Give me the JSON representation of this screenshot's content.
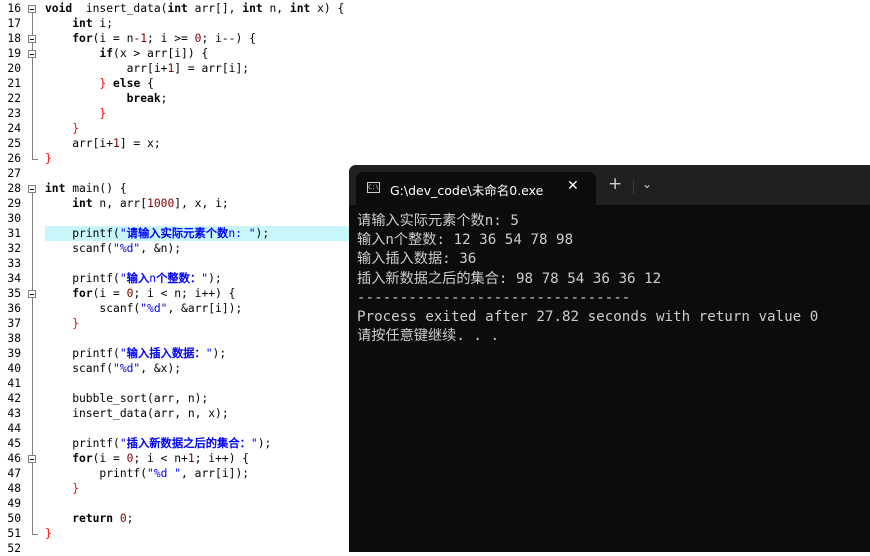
{
  "editor": {
    "highlight_line": "31",
    "lines": [
      {
        "n": "16",
        "fold": "box",
        "segs": [
          [
            "kw",
            "void"
          ],
          [
            "",
            "  insert_data("
          ],
          [
            "kw",
            "int"
          ],
          [
            "",
            " arr[], "
          ],
          [
            "kw",
            "int"
          ],
          [
            "",
            " n, "
          ],
          [
            "kw",
            "int"
          ],
          [
            "",
            " x) {"
          ]
        ]
      },
      {
        "n": "17",
        "fold": "line",
        "segs": [
          [
            "",
            "    "
          ],
          [
            "kw",
            "int"
          ],
          [
            "",
            " i;"
          ]
        ]
      },
      {
        "n": "18",
        "fold": "box",
        "segs": [
          [
            "",
            "    "
          ],
          [
            "kw",
            "for"
          ],
          [
            "",
            "(i = n"
          ],
          [
            "num",
            "-1"
          ],
          [
            "",
            "; i >= "
          ],
          [
            "num",
            "0"
          ],
          [
            "",
            "; i--) {"
          ]
        ]
      },
      {
        "n": "19",
        "fold": "box",
        "segs": [
          [
            "",
            "        "
          ],
          [
            "kw",
            "if"
          ],
          [
            "",
            "(x > arr[i]) {"
          ]
        ]
      },
      {
        "n": "20",
        "fold": "line",
        "segs": [
          [
            "",
            "            arr[i+"
          ],
          [
            "num",
            "1"
          ],
          [
            "",
            "] = arr[i];"
          ]
        ]
      },
      {
        "n": "21",
        "fold": "line",
        "segs": [
          [
            "",
            "        "
          ],
          [
            "op",
            "}"
          ],
          [
            "",
            " "
          ],
          [
            "kw",
            "else"
          ],
          [
            "",
            " {"
          ]
        ]
      },
      {
        "n": "22",
        "fold": "line",
        "segs": [
          [
            "",
            "            "
          ],
          [
            "kw",
            "break"
          ],
          [
            "",
            ";"
          ]
        ]
      },
      {
        "n": "23",
        "fold": "line",
        "segs": [
          [
            "",
            "        "
          ],
          [
            "op",
            "}"
          ]
        ]
      },
      {
        "n": "24",
        "fold": "line",
        "segs": [
          [
            "",
            "    "
          ],
          [
            "op",
            "}"
          ]
        ]
      },
      {
        "n": "25",
        "fold": "line",
        "segs": [
          [
            "",
            "    arr[i+"
          ],
          [
            "num",
            "1"
          ],
          [
            "",
            "] = x;"
          ]
        ]
      },
      {
        "n": "26",
        "fold": "end",
        "segs": [
          [
            "op",
            "}"
          ]
        ]
      },
      {
        "n": "27",
        "fold": "",
        "segs": []
      },
      {
        "n": "28",
        "fold": "box",
        "segs": [
          [
            "kw",
            "int"
          ],
          [
            "",
            " main() {"
          ]
        ]
      },
      {
        "n": "29",
        "fold": "line",
        "segs": [
          [
            "",
            "    "
          ],
          [
            "kw",
            "int"
          ],
          [
            "",
            " n, arr["
          ],
          [
            "num",
            "1000"
          ],
          [
            "",
            "], x, i;"
          ]
        ]
      },
      {
        "n": "30",
        "fold": "line",
        "segs": []
      },
      {
        "n": "31",
        "fold": "line",
        "segs": [
          [
            "",
            "    printf("
          ],
          [
            "str",
            "\""
          ],
          [
            "strcn",
            "请输入实际元素个数"
          ],
          [
            "str",
            "n: \""
          ],
          [
            "",
            ");"
          ]
        ]
      },
      {
        "n": "32",
        "fold": "line",
        "segs": [
          [
            "",
            "    scanf("
          ],
          [
            "str",
            "\"%d\""
          ],
          [
            "",
            ", &n);"
          ]
        ]
      },
      {
        "n": "33",
        "fold": "line",
        "segs": []
      },
      {
        "n": "34",
        "fold": "line",
        "segs": [
          [
            "",
            "    printf("
          ],
          [
            "str",
            "\""
          ],
          [
            "strcn",
            "输入"
          ],
          [
            "str",
            "n"
          ],
          [
            "strcn",
            "个整数："
          ],
          [
            "str",
            "\""
          ],
          [
            "",
            ");"
          ]
        ]
      },
      {
        "n": "35",
        "fold": "box",
        "segs": [
          [
            "",
            "    "
          ],
          [
            "kw",
            "for"
          ],
          [
            "",
            "(i = "
          ],
          [
            "num",
            "0"
          ],
          [
            "",
            "; i < n; i++) {"
          ]
        ]
      },
      {
        "n": "36",
        "fold": "line",
        "segs": [
          [
            "",
            "        scanf("
          ],
          [
            "str",
            "\"%d\""
          ],
          [
            "",
            ", &arr[i]);"
          ]
        ]
      },
      {
        "n": "37",
        "fold": "line",
        "segs": [
          [
            "",
            "    "
          ],
          [
            "op",
            "}"
          ]
        ]
      },
      {
        "n": "38",
        "fold": "line",
        "segs": []
      },
      {
        "n": "39",
        "fold": "line",
        "segs": [
          [
            "",
            "    printf("
          ],
          [
            "str",
            "\""
          ],
          [
            "strcn",
            "输入插入数据："
          ],
          [
            "str",
            "\""
          ],
          [
            "",
            ");"
          ]
        ]
      },
      {
        "n": "40",
        "fold": "line",
        "segs": [
          [
            "",
            "    scanf("
          ],
          [
            "str",
            "\"%d\""
          ],
          [
            "",
            ", &x);"
          ]
        ]
      },
      {
        "n": "41",
        "fold": "line",
        "segs": []
      },
      {
        "n": "42",
        "fold": "line",
        "segs": [
          [
            "",
            "    bubble_sort(arr, n);"
          ]
        ]
      },
      {
        "n": "43",
        "fold": "line",
        "segs": [
          [
            "",
            "    insert_data(arr, n, x);"
          ]
        ]
      },
      {
        "n": "44",
        "fold": "line",
        "segs": []
      },
      {
        "n": "45",
        "fold": "line",
        "segs": [
          [
            "",
            "    printf("
          ],
          [
            "str",
            "\""
          ],
          [
            "strcn",
            "插入新数据之后的集合："
          ],
          [
            "str",
            "\""
          ],
          [
            "",
            ");"
          ]
        ]
      },
      {
        "n": "46",
        "fold": "box",
        "segs": [
          [
            "",
            "    "
          ],
          [
            "kw",
            "for"
          ],
          [
            "",
            "(i = "
          ],
          [
            "num",
            "0"
          ],
          [
            "",
            "; i < n+"
          ],
          [
            "num",
            "1"
          ],
          [
            "",
            "; i++) {"
          ]
        ]
      },
      {
        "n": "47",
        "fold": "line",
        "segs": [
          [
            "",
            "        printf("
          ],
          [
            "str",
            "\"%d \""
          ],
          [
            "",
            ", arr[i]);"
          ]
        ]
      },
      {
        "n": "48",
        "fold": "line",
        "segs": [
          [
            "",
            "    "
          ],
          [
            "op",
            "}"
          ]
        ]
      },
      {
        "n": "49",
        "fold": "line",
        "segs": []
      },
      {
        "n": "50",
        "fold": "line",
        "segs": [
          [
            "",
            "    "
          ],
          [
            "kw",
            "return"
          ],
          [
            "",
            " "
          ],
          [
            "num",
            "0"
          ],
          [
            "",
            ";"
          ]
        ]
      },
      {
        "n": "51",
        "fold": "end",
        "segs": [
          [
            "op",
            "}"
          ]
        ]
      },
      {
        "n": "52",
        "fold": "",
        "segs": []
      }
    ]
  },
  "terminal": {
    "tab_title": "G:\\dev_code\\未命名0.exe",
    "tab_icon_text": "C:\\",
    "close_glyph": "✕",
    "new_tab_glyph": "+",
    "dropdown_glyph": "⌄",
    "lines": [
      "请输入实际元素个数n: 5",
      "输入n个整数: 12 36 54 78 98",
      "输入插入数据: 36",
      "插入新数据之后的集合: 98 78 54 36 36 12",
      "--------------------------------",
      "Process exited after 27.82 seconds with return value 0",
      "请按任意键继续. . ."
    ]
  }
}
